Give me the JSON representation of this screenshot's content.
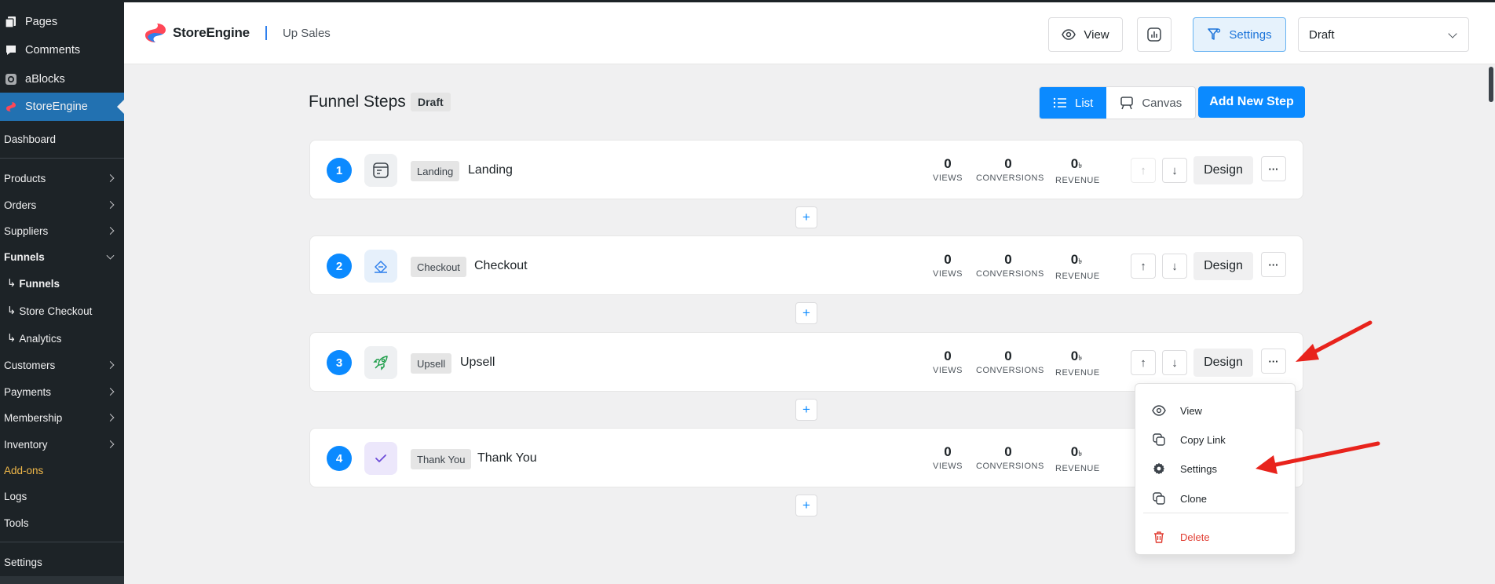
{
  "sidebar": {
    "items": [
      {
        "key": "pages",
        "label": "Pages",
        "icon": "pages-icon"
      },
      {
        "key": "comments",
        "label": "Comments",
        "icon": "comment-icon"
      },
      {
        "key": "ablocks",
        "label": "aBlocks",
        "icon": "ablocks-icon"
      },
      {
        "key": "storeengine",
        "label": "StoreEngine",
        "icon": "storeengine-icon"
      },
      {
        "key": "dashboard",
        "label": "Dashboard"
      },
      {
        "key": "products",
        "label": "Products"
      },
      {
        "key": "orders",
        "label": "Orders"
      },
      {
        "key": "suppliers",
        "label": "Suppliers"
      },
      {
        "key": "funnels",
        "label": "Funnels"
      },
      {
        "key": "sub-funnels",
        "label": "Funnels"
      },
      {
        "key": "store-checkout",
        "label": "Store Checkout"
      },
      {
        "key": "analytics",
        "label": "Analytics"
      },
      {
        "key": "customers",
        "label": "Customers"
      },
      {
        "key": "payments",
        "label": "Payments"
      },
      {
        "key": "membership",
        "label": "Membership"
      },
      {
        "key": "inventory",
        "label": "Inventory"
      },
      {
        "key": "add-ons",
        "label": "Add-ons"
      },
      {
        "key": "logs",
        "label": "Logs"
      },
      {
        "key": "tools",
        "label": "Tools"
      },
      {
        "key": "settings",
        "label": "Settings"
      }
    ],
    "sub_prefix": "↳"
  },
  "header": {
    "brand": "StoreEngine",
    "subtitle": "Up Sales",
    "view_label": "View",
    "settings_label": "Settings",
    "status_select": "Draft"
  },
  "main": {
    "title": "Funnel Steps",
    "title_badge": "Draft",
    "view_toggle": {
      "list": "List",
      "canvas": "Canvas"
    },
    "add_step_label": "Add New Step",
    "stat_labels": {
      "views": "VIEWS",
      "conversions": "CONVERSIONS",
      "revenue": "REVENUE"
    },
    "currency": "৳",
    "design_label": "Design",
    "more_label": "···",
    "plus_label": "+",
    "up_arrow": "↑",
    "down_arrow": "↓",
    "steps": [
      {
        "number": "1",
        "type": "Landing",
        "name": "Landing",
        "views": "0",
        "conversions": "0",
        "revenue": "0",
        "icon": "landing-page-icon"
      },
      {
        "number": "2",
        "type": "Checkout",
        "name": "Checkout",
        "views": "0",
        "conversions": "0",
        "revenue": "0",
        "icon": "checkout-icon"
      },
      {
        "number": "3",
        "type": "Upsell",
        "name": "Upsell",
        "views": "0",
        "conversions": "0",
        "revenue": "0",
        "icon": "rocket-icon"
      },
      {
        "number": "4",
        "type": "Thank You",
        "name": "Thank You",
        "views": "0",
        "conversions": "0",
        "revenue": "0",
        "icon": "check-icon"
      }
    ]
  },
  "menu": {
    "items": [
      {
        "label": "View",
        "icon": "eye-icon"
      },
      {
        "label": "Copy Link",
        "icon": "copy-icon"
      },
      {
        "label": "Settings",
        "icon": "gear-icon"
      },
      {
        "label": "Clone",
        "icon": "clone-icon"
      },
      {
        "label": "Delete",
        "icon": "trash-icon"
      }
    ]
  },
  "colors": {
    "primary": "#0b8aff",
    "sidebar_bg": "#1d2327",
    "sidebar_active": "#2271b1",
    "danger": "#e03c31",
    "annotation": "#e8231c"
  }
}
